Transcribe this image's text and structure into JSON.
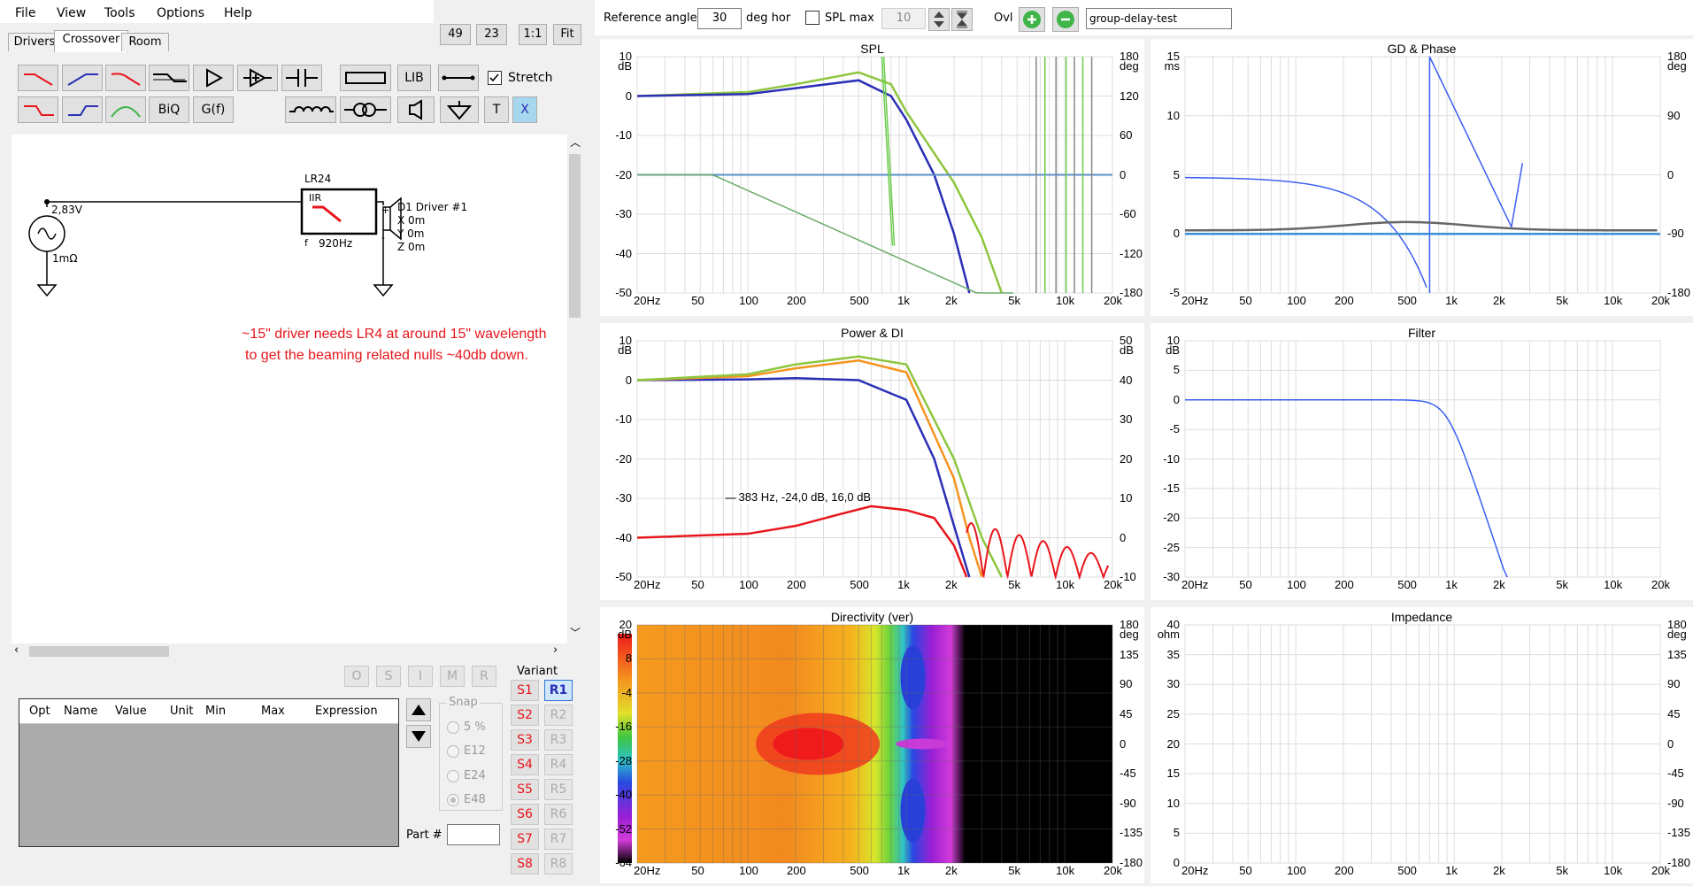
{
  "menu": {
    "file": "File",
    "view": "View",
    "tools": "Tools",
    "options": "Options",
    "help": "Help"
  },
  "tabs": {
    "drivers": "Drivers",
    "crossover": "Crossover",
    "room": "Room"
  },
  "zoom_buttons": {
    "b49": "49",
    "b23": "23",
    "one_to_one": "1:1",
    "fit": "Fit"
  },
  "toolbar": {
    "lib": "LIB",
    "stretch": "Stretch",
    "biq": "BiQ",
    "gf": "G(f)",
    "t": "T",
    "x": "X"
  },
  "circuit": {
    "source_voltage": "2,83V",
    "source_resistance": "1mΩ",
    "filter_name": "LR24",
    "filter_type": "IIR",
    "filter_f": "f",
    "filter_freq": "920Hz",
    "driver_name": "D1 Driver #1",
    "driver_x": "X 0m",
    "driver_y": "Y 0m",
    "driver_z": "Z 0m",
    "plus": "+",
    "minus": "-"
  },
  "annotation": {
    "line1": "~15\" driver needs LR4 at around 15\" wavelength",
    "line2": "to get the beaming related nulls ~40db down."
  },
  "opt_buttons": [
    "O",
    "S",
    "I",
    "M",
    "R"
  ],
  "opt_table": {
    "headers": [
      "Opt",
      "Name",
      "Value",
      "Unit",
      "Min",
      "Max",
      "Expression"
    ]
  },
  "snap": {
    "label": "Snap",
    "options": [
      "5 %",
      "E12",
      "E24",
      "E48"
    ]
  },
  "part_label": "Part #",
  "variant": {
    "label": "Variant",
    "s": [
      "S1",
      "S2",
      "S3",
      "S4",
      "S5",
      "S6",
      "S7",
      "S8"
    ],
    "r": [
      "R1",
      "R2",
      "R3",
      "R4",
      "R5",
      "R6",
      "R7",
      "R8"
    ]
  },
  "right_toolbar": {
    "ref_angle_label": "Reference angle",
    "ref_angle_value": "30",
    "deg_hor": "deg hor",
    "spl_max_label": "SPL max",
    "spl_max_value": "10",
    "ovl_label": "Ovl",
    "preset_value": "group-delay-test"
  },
  "charts": {
    "spl": {
      "title": "SPL",
      "left_unit": "dB",
      "right_unit": "deg",
      "left_ticks": [
        "10",
        "0",
        "-10",
        "-20",
        "-30",
        "-40",
        "-50"
      ],
      "right_ticks": [
        "180",
        "120",
        "60",
        "0",
        "-60",
        "-120",
        "-180"
      ]
    },
    "gd": {
      "title": "GD & Phase",
      "left_unit": "ms",
      "right_unit": "deg",
      "left_ticks": [
        "15",
        "10",
        "5",
        "0",
        "-5"
      ],
      "right_ticks": [
        "180",
        "90",
        "0",
        "-90",
        "-180"
      ]
    },
    "power": {
      "title": "Power & DI",
      "left_unit": "dB",
      "right_unit": "dB",
      "left_ticks": [
        "10",
        "0",
        "-10",
        "-20",
        "-30",
        "-40",
        "-50"
      ],
      "right_ticks": [
        "50",
        "40",
        "30",
        "20",
        "10",
        "0",
        "-10"
      ],
      "annotation": "383 Hz, -24,0 dB, 16,0 dB"
    },
    "filter": {
      "title": "Filter",
      "left_unit": "dB",
      "left_ticks": [
        "10",
        "5",
        "0",
        "-5",
        "-10",
        "-15",
        "-20",
        "-25",
        "-30"
      ]
    },
    "directivity": {
      "title": "Directivity (ver)",
      "left_unit": "dB",
      "right_unit": "deg",
      "left_ticks": [
        "20",
        "8",
        "-4",
        "-16",
        "-28",
        "-40",
        "-52",
        "-64"
      ],
      "right_ticks": [
        "180",
        "135",
        "90",
        "45",
        "0",
        "-45",
        "-90",
        "-135",
        "-180"
      ]
    },
    "impedance": {
      "title": "Impedance",
      "left_unit": "ohm",
      "right_unit": "deg",
      "left_ticks": [
        "40",
        "35",
        "30",
        "25",
        "20",
        "15",
        "10",
        "5",
        "0"
      ],
      "right_ticks": [
        "180",
        "135",
        "90",
        "45",
        "0",
        "-45",
        "-90",
        "-135",
        "-180"
      ]
    },
    "freq_ticks": [
      "20Hz",
      "50",
      "100",
      "200",
      "500",
      "1k",
      "2k",
      "5k",
      "10k",
      "20k"
    ]
  },
  "colors": {
    "spl_green": "#8ec63f",
    "spl_blue": "#2b2fb5",
    "orange": "#f5941f",
    "red": "#e8161c",
    "accent_green": "#3fb549",
    "x_btn": "#a7d6ef"
  },
  "chart_data": [
    {
      "type": "line",
      "title": "SPL",
      "x_scale": "log",
      "xlim": [
        20,
        20000
      ],
      "ylim": [
        -50,
        10
      ],
      "series": [
        {
          "x": [
            20,
            100,
            200,
            500,
            800,
            1000,
            1500,
            2000,
            2500
          ],
          "values": [
            0,
            0.5,
            2,
            4,
            0,
            -6,
            -20,
            -35,
            -50
          ]
        },
        {
          "x": [
            20,
            100,
            200,
            500,
            800,
            1000,
            2000,
            3000,
            4000
          ],
          "values": [
            0,
            1,
            3,
            6,
            3,
            -4,
            -22,
            -36,
            -50
          ]
        }
      ]
    },
    {
      "type": "line",
      "title": "Power & DI",
      "x_scale": "log",
      "xlim": [
        20,
        20000
      ],
      "ylim": [
        -50,
        10
      ],
      "series": [
        {
          "x": [
            20,
            100,
            200,
            500,
            1000,
            1500,
            2000,
            2500
          ],
          "values": [
            0,
            0.2,
            0.5,
            0,
            -5,
            -20,
            -37,
            -50
          ]
        },
        {
          "x": [
            20,
            100,
            200,
            500,
            1000,
            2000,
            2500,
            3000
          ],
          "values": [
            0,
            1,
            3,
            5,
            2,
            -25,
            -40,
            -50
          ]
        },
        {
          "x": [
            20,
            100,
            200,
            500,
            1000,
            2000,
            3000,
            4000
          ],
          "values": [
            0,
            1.5,
            4,
            6,
            4,
            -20,
            -40,
            -50
          ]
        },
        {
          "x": [
            20,
            100,
            200,
            383,
            600,
            1000,
            1500,
            2000,
            2400
          ],
          "values": [
            -40,
            -39,
            -37,
            -34,
            -32,
            -33,
            -35,
            -42,
            -50
          ]
        }
      ]
    }
  ]
}
